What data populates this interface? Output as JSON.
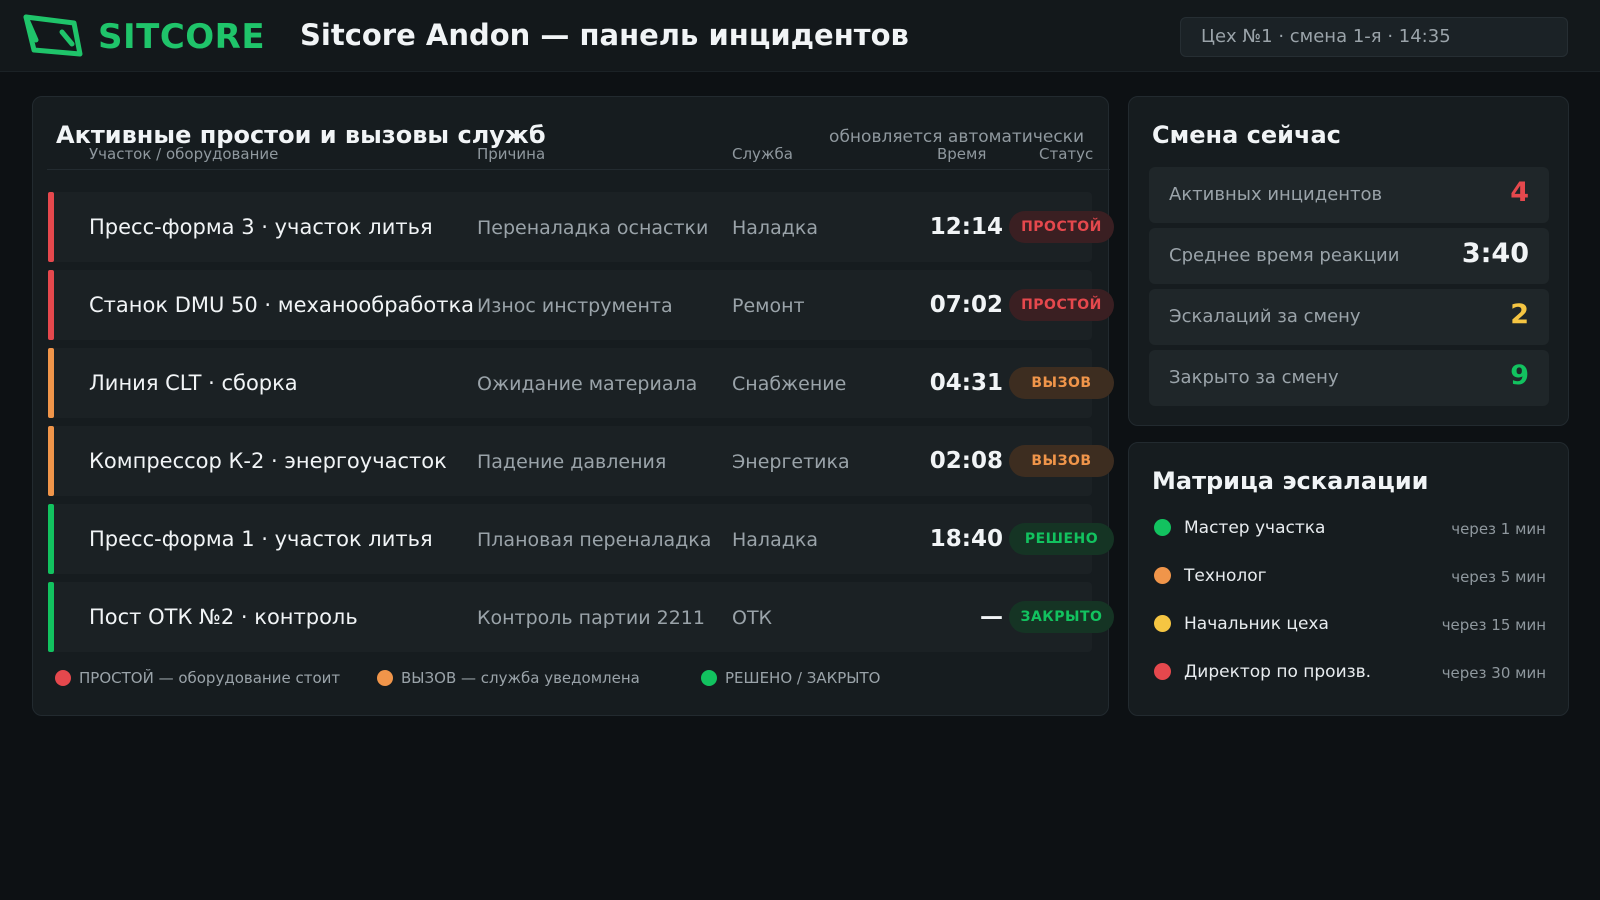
{
  "header": {
    "logo_text": "SITCORE",
    "title": "Sitcore Andon — панель инцидентов",
    "shift_info": "Цех №1 · смена 1-я · 14:35"
  },
  "colors": {
    "brand": "#1fc46a",
    "downtime": "#e5484d",
    "call": "#f0954a",
    "resolved": "#12c25f",
    "warning": "#f5c542"
  },
  "incidents": {
    "title": "Активные простои и вызовы служб",
    "auto_note": "обновляется автоматически",
    "columns": {
      "equipment": "Участок / оборудование",
      "cause": "Причина",
      "service": "Служба",
      "time": "Время",
      "status": "Статус"
    },
    "rows": [
      {
        "equipment": "Пресс-форма 3 · участок литья",
        "cause": "Переналадка оснастки",
        "service": "Наладка",
        "time": "12:14",
        "status": "ПРОСТОЙ",
        "kind": "downtime"
      },
      {
        "equipment": "Станок DMU 50 · механообработка",
        "cause": "Износ инструмента",
        "service": "Ремонт",
        "time": "07:02",
        "status": "ПРОСТОЙ",
        "kind": "downtime"
      },
      {
        "equipment": "Линия CLT · сборка",
        "cause": "Ожидание материала",
        "service": "Снабжение",
        "time": "04:31",
        "status": "ВЫЗОВ",
        "kind": "call"
      },
      {
        "equipment": "Компрессор К-2 · энергоучасток",
        "cause": "Падение давления",
        "service": "Энергетика",
        "time": "02:08",
        "status": "ВЫЗОВ",
        "kind": "call"
      },
      {
        "equipment": "Пресс-форма 1 · участок литья",
        "cause": "Плановая переналадка",
        "service": "Наладка",
        "time": "18:40",
        "status": "РЕШЕНО",
        "kind": "resolved"
      },
      {
        "equipment": "Пост ОТК №2 · контроль",
        "cause": "Контроль партии 2211",
        "service": "ОТК",
        "time": "—",
        "status": "ЗАКРЫТО",
        "kind": "resolved"
      }
    ],
    "legend": [
      {
        "text": "ПРОСТОЙ — оборудование стоит",
        "kind": "downtime"
      },
      {
        "text": "ВЫЗОВ — служба уведомлена",
        "kind": "call"
      },
      {
        "text": "РЕШЕНО / ЗАКРЫТО",
        "kind": "resolved"
      }
    ]
  },
  "shift": {
    "title": "Смена сейчас",
    "stats": [
      {
        "label": "Активных инцидентов",
        "value": "4",
        "color": "#e5484d"
      },
      {
        "label": "Среднее время реакции",
        "value": "3:40",
        "color": "#f1f4f6"
      },
      {
        "label": "Эскалаций за смену",
        "value": "2",
        "color": "#f5c542"
      },
      {
        "label": "Закрыто за смену",
        "value": "9",
        "color": "#12c25f"
      }
    ]
  },
  "escalation": {
    "title": "Матрица эскалации",
    "levels": [
      {
        "role": "Мастер участка",
        "delay": "через 1 мин",
        "color": "#12c25f"
      },
      {
        "role": "Технолог",
        "delay": "через 5 мин",
        "color": "#f0954a"
      },
      {
        "role": "Начальник цеха",
        "delay": "через 15 мин",
        "color": "#f5c542"
      },
      {
        "role": "Директор по произв.",
        "delay": "через 30 мин",
        "color": "#e5484d"
      }
    ]
  }
}
